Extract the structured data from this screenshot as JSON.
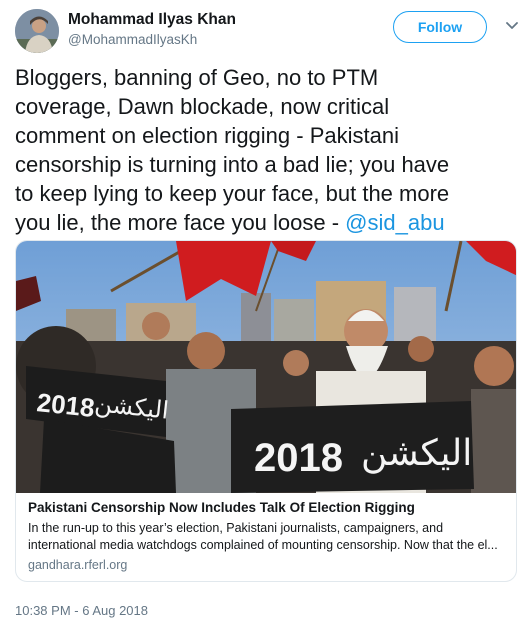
{
  "author": {
    "display_name": "Mohammad Ilyas Khan",
    "handle": "@MohammadIlyasKh"
  },
  "follow_button": {
    "label": "Follow"
  },
  "tweet": {
    "text": "Bloggers, banning of Geo, no to PTM\ncoverage, Dawn blockade, now critical\ncomment on election rigging - Pakistani\ncensorship is turning into a bad lie; you have\nto keep lying to keep your face, but the more\nyou lie, the more face you loose - ",
    "mention": "@sid_abu",
    "timestamp": "10:38 PM - 6 Aug 2018"
  },
  "card": {
    "banner_left": "2018",
    "banner_left_urdu": "الیکشن",
    "banner_right": "2018",
    "banner_right_urdu": "الیکشن",
    "title": "Pakistani Censorship Now Includes Talk Of Election Rigging",
    "description_line1": "In the run-up to this year’s election, Pakistani journalists, campaigners, and",
    "description_line2": "international media watchdogs complained of mounting censorship. Now that the el...",
    "domain": "gandhara.rferl.org"
  },
  "colors": {
    "accent": "#1da1f2",
    "link": "#1b95e0",
    "secondary_text": "#657786",
    "flag_red": "#d01c1f"
  },
  "icons": {
    "menu": "chevron-down-icon"
  }
}
